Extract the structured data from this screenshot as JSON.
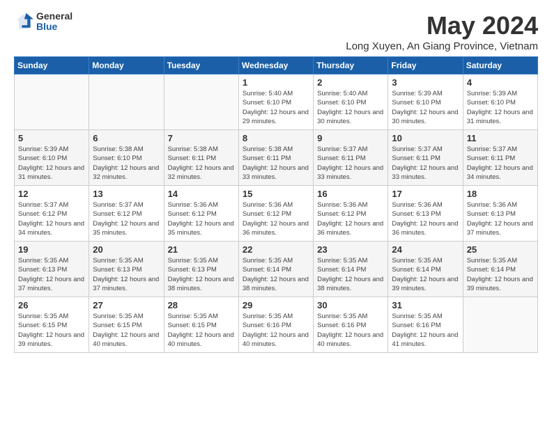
{
  "logo": {
    "general": "General",
    "blue": "Blue"
  },
  "title": "May 2024",
  "location": "Long Xuyen, An Giang Province, Vietnam",
  "weekdays": [
    "Sunday",
    "Monday",
    "Tuesday",
    "Wednesday",
    "Thursday",
    "Friday",
    "Saturday"
  ],
  "weeks": [
    [
      {
        "day": "",
        "info": ""
      },
      {
        "day": "",
        "info": ""
      },
      {
        "day": "",
        "info": ""
      },
      {
        "day": "1",
        "info": "Sunrise: 5:40 AM\nSunset: 6:10 PM\nDaylight: 12 hours\nand 29 minutes."
      },
      {
        "day": "2",
        "info": "Sunrise: 5:40 AM\nSunset: 6:10 PM\nDaylight: 12 hours\nand 30 minutes."
      },
      {
        "day": "3",
        "info": "Sunrise: 5:39 AM\nSunset: 6:10 PM\nDaylight: 12 hours\nand 30 minutes."
      },
      {
        "day": "4",
        "info": "Sunrise: 5:39 AM\nSunset: 6:10 PM\nDaylight: 12 hours\nand 31 minutes."
      }
    ],
    [
      {
        "day": "5",
        "info": "Sunrise: 5:39 AM\nSunset: 6:10 PM\nDaylight: 12 hours\nand 31 minutes."
      },
      {
        "day": "6",
        "info": "Sunrise: 5:38 AM\nSunset: 6:10 PM\nDaylight: 12 hours\nand 32 minutes."
      },
      {
        "day": "7",
        "info": "Sunrise: 5:38 AM\nSunset: 6:11 PM\nDaylight: 12 hours\nand 32 minutes."
      },
      {
        "day": "8",
        "info": "Sunrise: 5:38 AM\nSunset: 6:11 PM\nDaylight: 12 hours\nand 33 minutes."
      },
      {
        "day": "9",
        "info": "Sunrise: 5:37 AM\nSunset: 6:11 PM\nDaylight: 12 hours\nand 33 minutes."
      },
      {
        "day": "10",
        "info": "Sunrise: 5:37 AM\nSunset: 6:11 PM\nDaylight: 12 hours\nand 33 minutes."
      },
      {
        "day": "11",
        "info": "Sunrise: 5:37 AM\nSunset: 6:11 PM\nDaylight: 12 hours\nand 34 minutes."
      }
    ],
    [
      {
        "day": "12",
        "info": "Sunrise: 5:37 AM\nSunset: 6:12 PM\nDaylight: 12 hours\nand 34 minutes."
      },
      {
        "day": "13",
        "info": "Sunrise: 5:37 AM\nSunset: 6:12 PM\nDaylight: 12 hours\nand 35 minutes."
      },
      {
        "day": "14",
        "info": "Sunrise: 5:36 AM\nSunset: 6:12 PM\nDaylight: 12 hours\nand 35 minutes."
      },
      {
        "day": "15",
        "info": "Sunrise: 5:36 AM\nSunset: 6:12 PM\nDaylight: 12 hours\nand 36 minutes."
      },
      {
        "day": "16",
        "info": "Sunrise: 5:36 AM\nSunset: 6:12 PM\nDaylight: 12 hours\nand 36 minutes."
      },
      {
        "day": "17",
        "info": "Sunrise: 5:36 AM\nSunset: 6:13 PM\nDaylight: 12 hours\nand 36 minutes."
      },
      {
        "day": "18",
        "info": "Sunrise: 5:36 AM\nSunset: 6:13 PM\nDaylight: 12 hours\nand 37 minutes."
      }
    ],
    [
      {
        "day": "19",
        "info": "Sunrise: 5:35 AM\nSunset: 6:13 PM\nDaylight: 12 hours\nand 37 minutes."
      },
      {
        "day": "20",
        "info": "Sunrise: 5:35 AM\nSunset: 6:13 PM\nDaylight: 12 hours\nand 37 minutes."
      },
      {
        "day": "21",
        "info": "Sunrise: 5:35 AM\nSunset: 6:13 PM\nDaylight: 12 hours\nand 38 minutes."
      },
      {
        "day": "22",
        "info": "Sunrise: 5:35 AM\nSunset: 6:14 PM\nDaylight: 12 hours\nand 38 minutes."
      },
      {
        "day": "23",
        "info": "Sunrise: 5:35 AM\nSunset: 6:14 PM\nDaylight: 12 hours\nand 38 minutes."
      },
      {
        "day": "24",
        "info": "Sunrise: 5:35 AM\nSunset: 6:14 PM\nDaylight: 12 hours\nand 39 minutes."
      },
      {
        "day": "25",
        "info": "Sunrise: 5:35 AM\nSunset: 6:14 PM\nDaylight: 12 hours\nand 39 minutes."
      }
    ],
    [
      {
        "day": "26",
        "info": "Sunrise: 5:35 AM\nSunset: 6:15 PM\nDaylight: 12 hours\nand 39 minutes."
      },
      {
        "day": "27",
        "info": "Sunrise: 5:35 AM\nSunset: 6:15 PM\nDaylight: 12 hours\nand 40 minutes."
      },
      {
        "day": "28",
        "info": "Sunrise: 5:35 AM\nSunset: 6:15 PM\nDaylight: 12 hours\nand 40 minutes."
      },
      {
        "day": "29",
        "info": "Sunrise: 5:35 AM\nSunset: 6:16 PM\nDaylight: 12 hours\nand 40 minutes."
      },
      {
        "day": "30",
        "info": "Sunrise: 5:35 AM\nSunset: 6:16 PM\nDaylight: 12 hours\nand 40 minutes."
      },
      {
        "day": "31",
        "info": "Sunrise: 5:35 AM\nSunset: 6:16 PM\nDaylight: 12 hours\nand 41 minutes."
      },
      {
        "day": "",
        "info": ""
      }
    ]
  ]
}
